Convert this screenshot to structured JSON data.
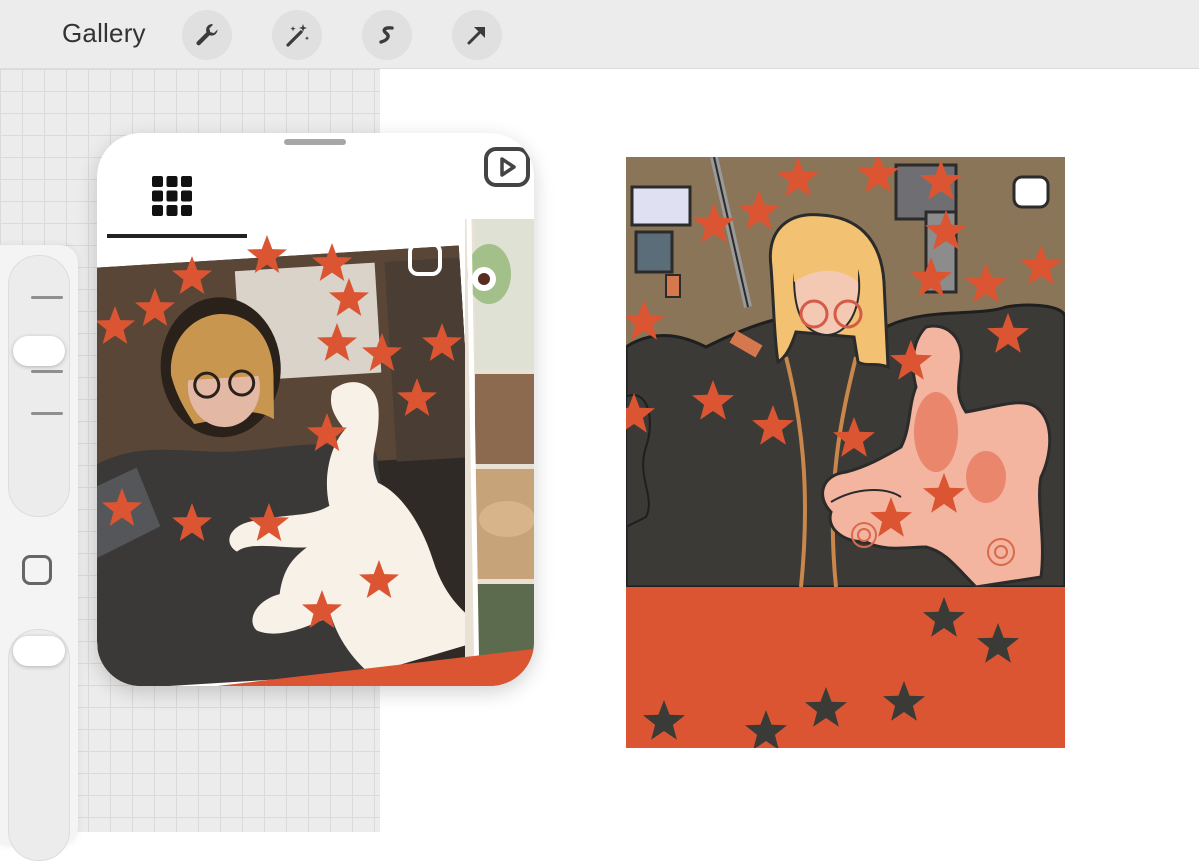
{
  "topbar": {
    "gallery_label": "Gallery",
    "tools": [
      "wrench-icon",
      "magic-wand-icon",
      "selection-icon",
      "transform-arrow-icon"
    ]
  },
  "sidebar": {
    "brush_size_level": 0.75,
    "opacity_level": 0.9
  },
  "pip_window": {
    "active_tab_icon": "grid-icon",
    "secondary_tab_icon": "reels-icon"
  },
  "colors": {
    "accent_orange": "#DB5533",
    "dark_gray": "#3A3A36",
    "brown_wall": "#8A7559",
    "skin_pink": "#F3B5A0",
    "hair_blonde": "#F2C172",
    "plush_white": "#F8F1EA"
  }
}
